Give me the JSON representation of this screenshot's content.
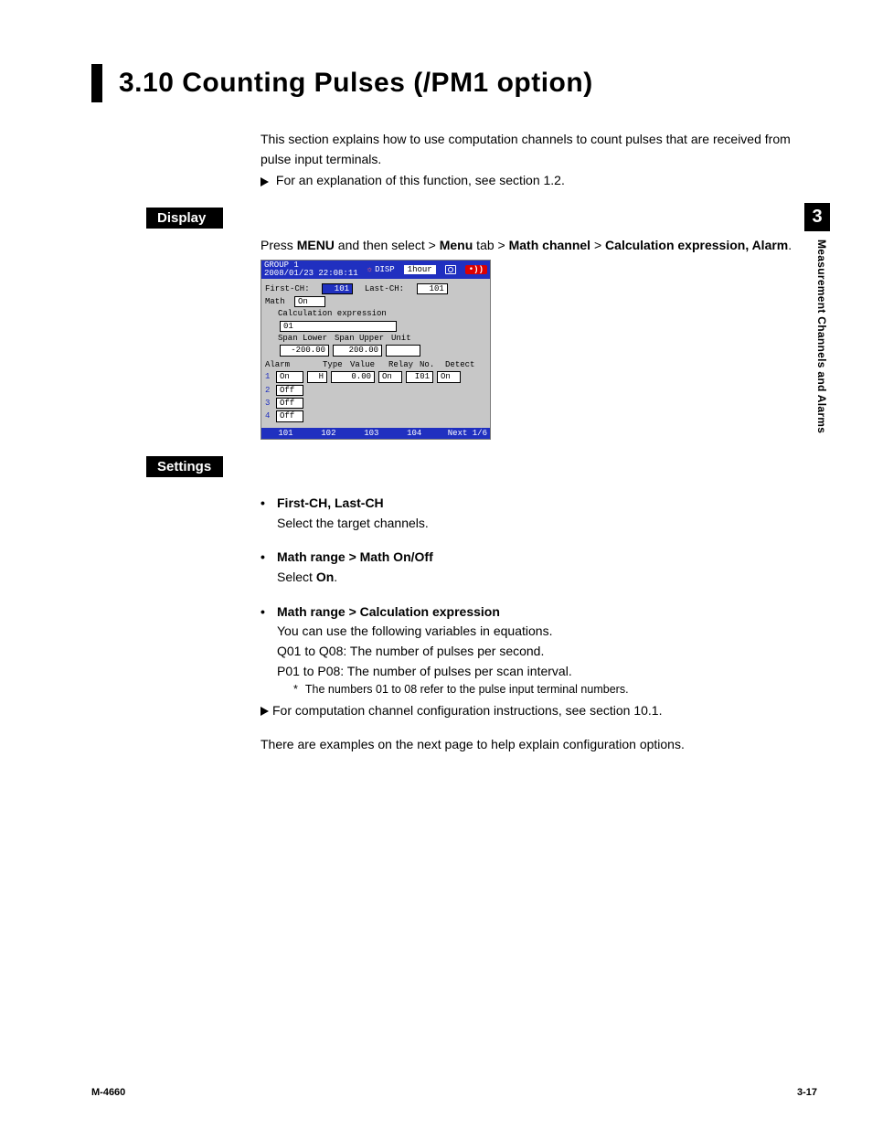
{
  "title": "3.10   Counting Pulses (/PM1 option)",
  "intro1": "This section explains how to use computation channels to count pulses that are received from pulse input terminals.",
  "intro2": "For an explanation of this function, see section 1.2.",
  "labels": {
    "display": "Display",
    "settings": "Settings"
  },
  "display_line_pre": "Press ",
  "display_line_menu": "MENU",
  "display_line_mid": " and then select > ",
  "display_path": [
    "Menu",
    " tab > ",
    "Math channel",
    " > ",
    "Calculation expression, Alarm"
  ],
  "ss": {
    "group": "GROUP 1",
    "datetime": "2008/01/23 22:08:11",
    "disp": "DISP",
    "timebar": "1hour",
    "firstch_l": "First-CH:",
    "firstch_v": "101",
    "lastch_l": "Last-CH:",
    "lastch_v": "101",
    "math_l": "Math",
    "math_v": "On",
    "calc_l": "Calculation expression",
    "calc_v": "01",
    "span_lo_l": "Span Lower",
    "span_lo_v": "-200.00",
    "span_up_l": "Span Upper",
    "span_up_v": "200.00",
    "unit_l": "Unit",
    "alarm_l": "Alarm",
    "cols": [
      "Type",
      "Value",
      "Relay",
      "No.",
      "Detect"
    ],
    "rows": [
      {
        "n": "1",
        "on": "On",
        "type": "H",
        "value": "0.00",
        "relay": "On",
        "no": "I01",
        "detect": "On"
      },
      {
        "n": "2",
        "on": "Off"
      },
      {
        "n": "3",
        "on": "Off"
      },
      {
        "n": "4",
        "on": "Off"
      }
    ],
    "tabs": [
      "101",
      "102",
      "103",
      "104"
    ],
    "next": "Next 1/6"
  },
  "settings": [
    {
      "h": "First-CH, Last-CH",
      "lines": [
        "Select the target channels."
      ]
    },
    {
      "h": "Math range > Math On/Off",
      "lines_html": [
        [
          "Select ",
          {
            "b": "On"
          },
          "."
        ]
      ]
    },
    {
      "h": "Math range > Calculation expression",
      "lines": [
        "You can use the following variables in equations.",
        "Q01 to Q08: The number of pulses per second.",
        "P01 to P08: The number of pulses per scan interval."
      ],
      "star": "The numbers 01 to 08 refer to the pulse input terminal numbers.",
      "arrow": "For computation channel configuration instructions, see section 10.1."
    }
  ],
  "closing": "There are examples on the next page to help explain configuration options.",
  "side": {
    "num": "3",
    "text": "Measurement Channels and Alarms"
  },
  "footer": {
    "left": "M-4660",
    "right": "3-17"
  }
}
